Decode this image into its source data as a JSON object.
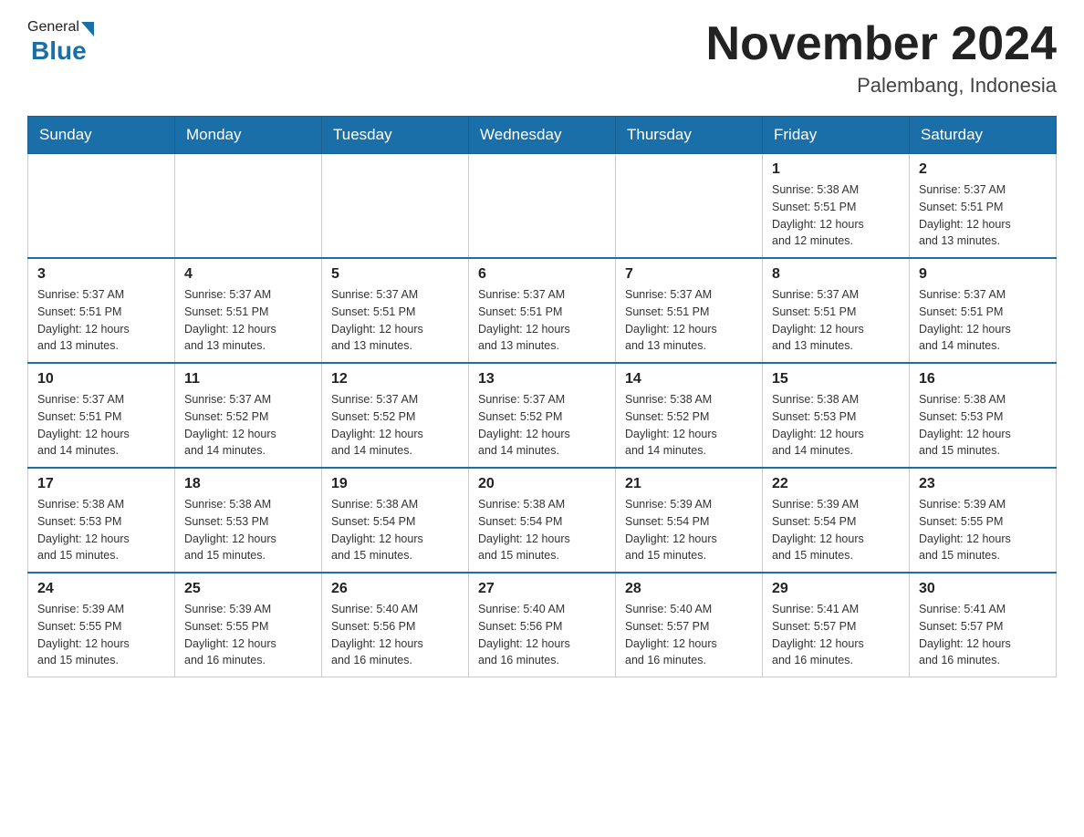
{
  "header": {
    "logo_general": "General",
    "logo_blue": "Blue",
    "month_title": "November 2024",
    "location": "Palembang, Indonesia"
  },
  "weekdays": [
    "Sunday",
    "Monday",
    "Tuesday",
    "Wednesday",
    "Thursday",
    "Friday",
    "Saturday"
  ],
  "weeks": [
    [
      {
        "day": "",
        "info": ""
      },
      {
        "day": "",
        "info": ""
      },
      {
        "day": "",
        "info": ""
      },
      {
        "day": "",
        "info": ""
      },
      {
        "day": "",
        "info": ""
      },
      {
        "day": "1",
        "info": "Sunrise: 5:38 AM\nSunset: 5:51 PM\nDaylight: 12 hours\nand 12 minutes."
      },
      {
        "day": "2",
        "info": "Sunrise: 5:37 AM\nSunset: 5:51 PM\nDaylight: 12 hours\nand 13 minutes."
      }
    ],
    [
      {
        "day": "3",
        "info": "Sunrise: 5:37 AM\nSunset: 5:51 PM\nDaylight: 12 hours\nand 13 minutes."
      },
      {
        "day": "4",
        "info": "Sunrise: 5:37 AM\nSunset: 5:51 PM\nDaylight: 12 hours\nand 13 minutes."
      },
      {
        "day": "5",
        "info": "Sunrise: 5:37 AM\nSunset: 5:51 PM\nDaylight: 12 hours\nand 13 minutes."
      },
      {
        "day": "6",
        "info": "Sunrise: 5:37 AM\nSunset: 5:51 PM\nDaylight: 12 hours\nand 13 minutes."
      },
      {
        "day": "7",
        "info": "Sunrise: 5:37 AM\nSunset: 5:51 PM\nDaylight: 12 hours\nand 13 minutes."
      },
      {
        "day": "8",
        "info": "Sunrise: 5:37 AM\nSunset: 5:51 PM\nDaylight: 12 hours\nand 13 minutes."
      },
      {
        "day": "9",
        "info": "Sunrise: 5:37 AM\nSunset: 5:51 PM\nDaylight: 12 hours\nand 14 minutes."
      }
    ],
    [
      {
        "day": "10",
        "info": "Sunrise: 5:37 AM\nSunset: 5:51 PM\nDaylight: 12 hours\nand 14 minutes."
      },
      {
        "day": "11",
        "info": "Sunrise: 5:37 AM\nSunset: 5:52 PM\nDaylight: 12 hours\nand 14 minutes."
      },
      {
        "day": "12",
        "info": "Sunrise: 5:37 AM\nSunset: 5:52 PM\nDaylight: 12 hours\nand 14 minutes."
      },
      {
        "day": "13",
        "info": "Sunrise: 5:37 AM\nSunset: 5:52 PM\nDaylight: 12 hours\nand 14 minutes."
      },
      {
        "day": "14",
        "info": "Sunrise: 5:38 AM\nSunset: 5:52 PM\nDaylight: 12 hours\nand 14 minutes."
      },
      {
        "day": "15",
        "info": "Sunrise: 5:38 AM\nSunset: 5:53 PM\nDaylight: 12 hours\nand 14 minutes."
      },
      {
        "day": "16",
        "info": "Sunrise: 5:38 AM\nSunset: 5:53 PM\nDaylight: 12 hours\nand 15 minutes."
      }
    ],
    [
      {
        "day": "17",
        "info": "Sunrise: 5:38 AM\nSunset: 5:53 PM\nDaylight: 12 hours\nand 15 minutes."
      },
      {
        "day": "18",
        "info": "Sunrise: 5:38 AM\nSunset: 5:53 PM\nDaylight: 12 hours\nand 15 minutes."
      },
      {
        "day": "19",
        "info": "Sunrise: 5:38 AM\nSunset: 5:54 PM\nDaylight: 12 hours\nand 15 minutes."
      },
      {
        "day": "20",
        "info": "Sunrise: 5:38 AM\nSunset: 5:54 PM\nDaylight: 12 hours\nand 15 minutes."
      },
      {
        "day": "21",
        "info": "Sunrise: 5:39 AM\nSunset: 5:54 PM\nDaylight: 12 hours\nand 15 minutes."
      },
      {
        "day": "22",
        "info": "Sunrise: 5:39 AM\nSunset: 5:54 PM\nDaylight: 12 hours\nand 15 minutes."
      },
      {
        "day": "23",
        "info": "Sunrise: 5:39 AM\nSunset: 5:55 PM\nDaylight: 12 hours\nand 15 minutes."
      }
    ],
    [
      {
        "day": "24",
        "info": "Sunrise: 5:39 AM\nSunset: 5:55 PM\nDaylight: 12 hours\nand 15 minutes."
      },
      {
        "day": "25",
        "info": "Sunrise: 5:39 AM\nSunset: 5:55 PM\nDaylight: 12 hours\nand 16 minutes."
      },
      {
        "day": "26",
        "info": "Sunrise: 5:40 AM\nSunset: 5:56 PM\nDaylight: 12 hours\nand 16 minutes."
      },
      {
        "day": "27",
        "info": "Sunrise: 5:40 AM\nSunset: 5:56 PM\nDaylight: 12 hours\nand 16 minutes."
      },
      {
        "day": "28",
        "info": "Sunrise: 5:40 AM\nSunset: 5:57 PM\nDaylight: 12 hours\nand 16 minutes."
      },
      {
        "day": "29",
        "info": "Sunrise: 5:41 AM\nSunset: 5:57 PM\nDaylight: 12 hours\nand 16 minutes."
      },
      {
        "day": "30",
        "info": "Sunrise: 5:41 AM\nSunset: 5:57 PM\nDaylight: 12 hours\nand 16 minutes."
      }
    ]
  ]
}
